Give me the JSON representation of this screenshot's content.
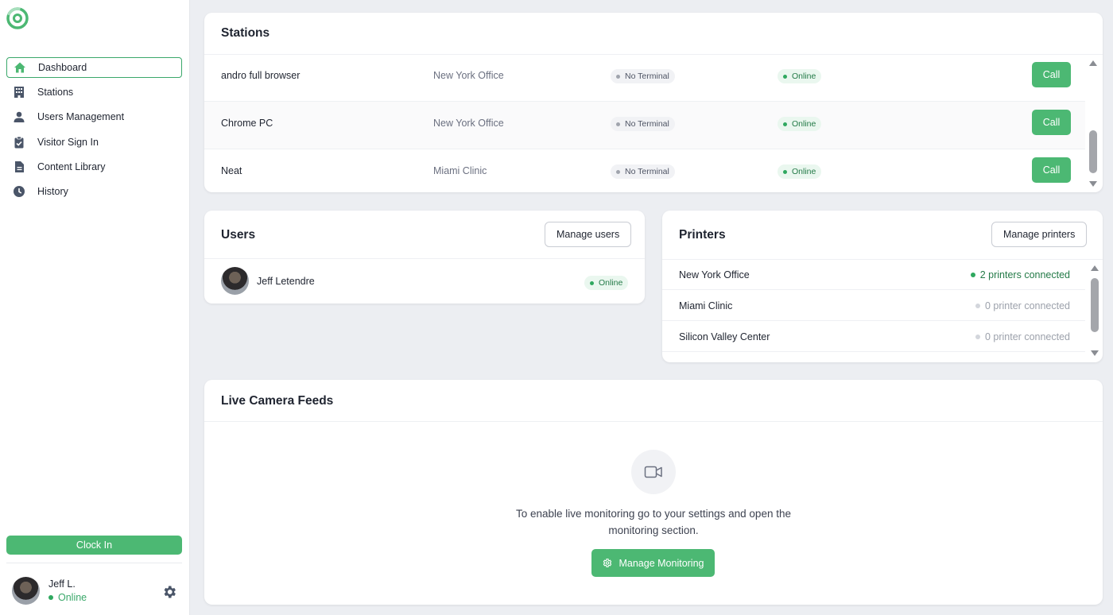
{
  "sidebar": {
    "nav": [
      {
        "label": "Dashboard",
        "icon": "home-icon",
        "active": true
      },
      {
        "label": "Stations",
        "icon": "building-icon"
      },
      {
        "label": "Users Management",
        "icon": "person-icon"
      },
      {
        "label": "Visitor Sign In",
        "icon": "clipboard-check-icon"
      },
      {
        "label": "Content Library",
        "icon": "document-icon"
      },
      {
        "label": "History",
        "icon": "clock-icon"
      }
    ],
    "clock_in_label": "Clock In",
    "current_user": {
      "name": "Jeff L.",
      "status": "Online"
    }
  },
  "stations": {
    "title": "Stations",
    "call_label": "Call",
    "rows": [
      {
        "name": "andro full browser",
        "location": "New York Office",
        "terminal": "No Terminal",
        "status": "Online"
      },
      {
        "name": "Chrome PC",
        "location": "New York Office",
        "terminal": "No Terminal",
        "status": "Online"
      },
      {
        "name": "Neat",
        "location": "Miami Clinic",
        "terminal": "No Terminal",
        "status": "Online"
      }
    ]
  },
  "users": {
    "title": "Users",
    "manage_label": "Manage users",
    "rows": [
      {
        "name": "Jeff Letendre",
        "status": "Online"
      }
    ]
  },
  "printers": {
    "title": "Printers",
    "manage_label": "Manage printers",
    "rows": [
      {
        "location": "New York Office",
        "status": "2 printers connected",
        "connected": true
      },
      {
        "location": "Miami Clinic",
        "status": "0 printer connected",
        "connected": false
      },
      {
        "location": "Silicon Valley Center",
        "status": "0 printer connected",
        "connected": false
      }
    ]
  },
  "camera": {
    "title": "Live Camera Feeds",
    "message": "To enable live monitoring go to your settings and open the monitoring section.",
    "button_label": "Manage Monitoring"
  },
  "colors": {
    "accent": "#4cb873",
    "online": "#2fa85f",
    "muted_dot": "#c9ccd3"
  }
}
